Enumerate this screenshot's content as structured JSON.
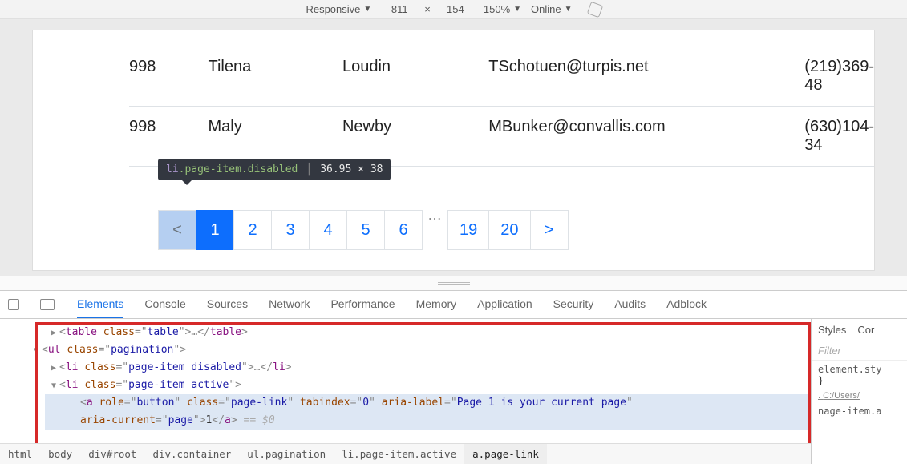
{
  "device_toolbar": {
    "mode": "Responsive",
    "width": "811",
    "height": "154",
    "zoom": "150%",
    "connection": "Online"
  },
  "table": {
    "rows": [
      {
        "id": "998",
        "first": "Tilena",
        "last": "Loudin",
        "email": "TSchotuen@turpis.net",
        "phone": "(219)369-48"
      },
      {
        "id": "998",
        "first": "Maly",
        "last": "Newby",
        "email": "MBunker@convallis.com",
        "phone": "(630)104-34"
      }
    ]
  },
  "inspect_tooltip": {
    "tag": "li",
    "classes": ".page-item.disabled",
    "dimensions": "36.95 × 38"
  },
  "pagination": {
    "prev": "<",
    "pages": [
      "1",
      "2",
      "3",
      "4",
      "5",
      "6"
    ],
    "ellipsis": "…",
    "late_pages": [
      "19",
      "20"
    ],
    "next": ">",
    "active_index": 0,
    "disabled_prev": true
  },
  "devtools": {
    "tabs": [
      "Elements",
      "Console",
      "Sources",
      "Network",
      "Performance",
      "Memory",
      "Application",
      "Security",
      "Audits",
      "Adblock"
    ],
    "active_tab": "Elements",
    "dom": {
      "line0": {
        "tag": "table",
        "attr": "class",
        "val": "table"
      },
      "line1": {
        "tag": "ul",
        "attr": "class",
        "val": "pagination"
      },
      "line2": {
        "tag": "li",
        "attr": "class",
        "val": "page-item disabled"
      },
      "line3": {
        "tag": "li",
        "attr": "class",
        "val": "page-item active"
      },
      "line4": {
        "tag": "a",
        "role_attr": "role",
        "role_val": "button",
        "class_attr": "class",
        "class_val": "page-link",
        "tab_attr": "tabindex",
        "tab_val": "0",
        "aria_attr": "aria-label",
        "aria_val": "Page 1 is your current page"
      },
      "line5": {
        "attr": "aria-current",
        "val": "page",
        "text": "1",
        "close": "a",
        "eq": " == $0"
      }
    },
    "breadcrumbs": [
      "html",
      "body",
      "div#root",
      "div.container",
      "ul.pagination",
      "li.page-item.active",
      "a.page-link"
    ],
    "active_crumb": 6,
    "styles": {
      "tabs": [
        "Styles",
        "Cor"
      ],
      "filter": "Filter",
      "rule_selector": "element.sty",
      "brace": "}",
      "source_prefix": ". ",
      "source": "C:/Users/",
      "next_rule": "nage-item.a"
    }
  }
}
